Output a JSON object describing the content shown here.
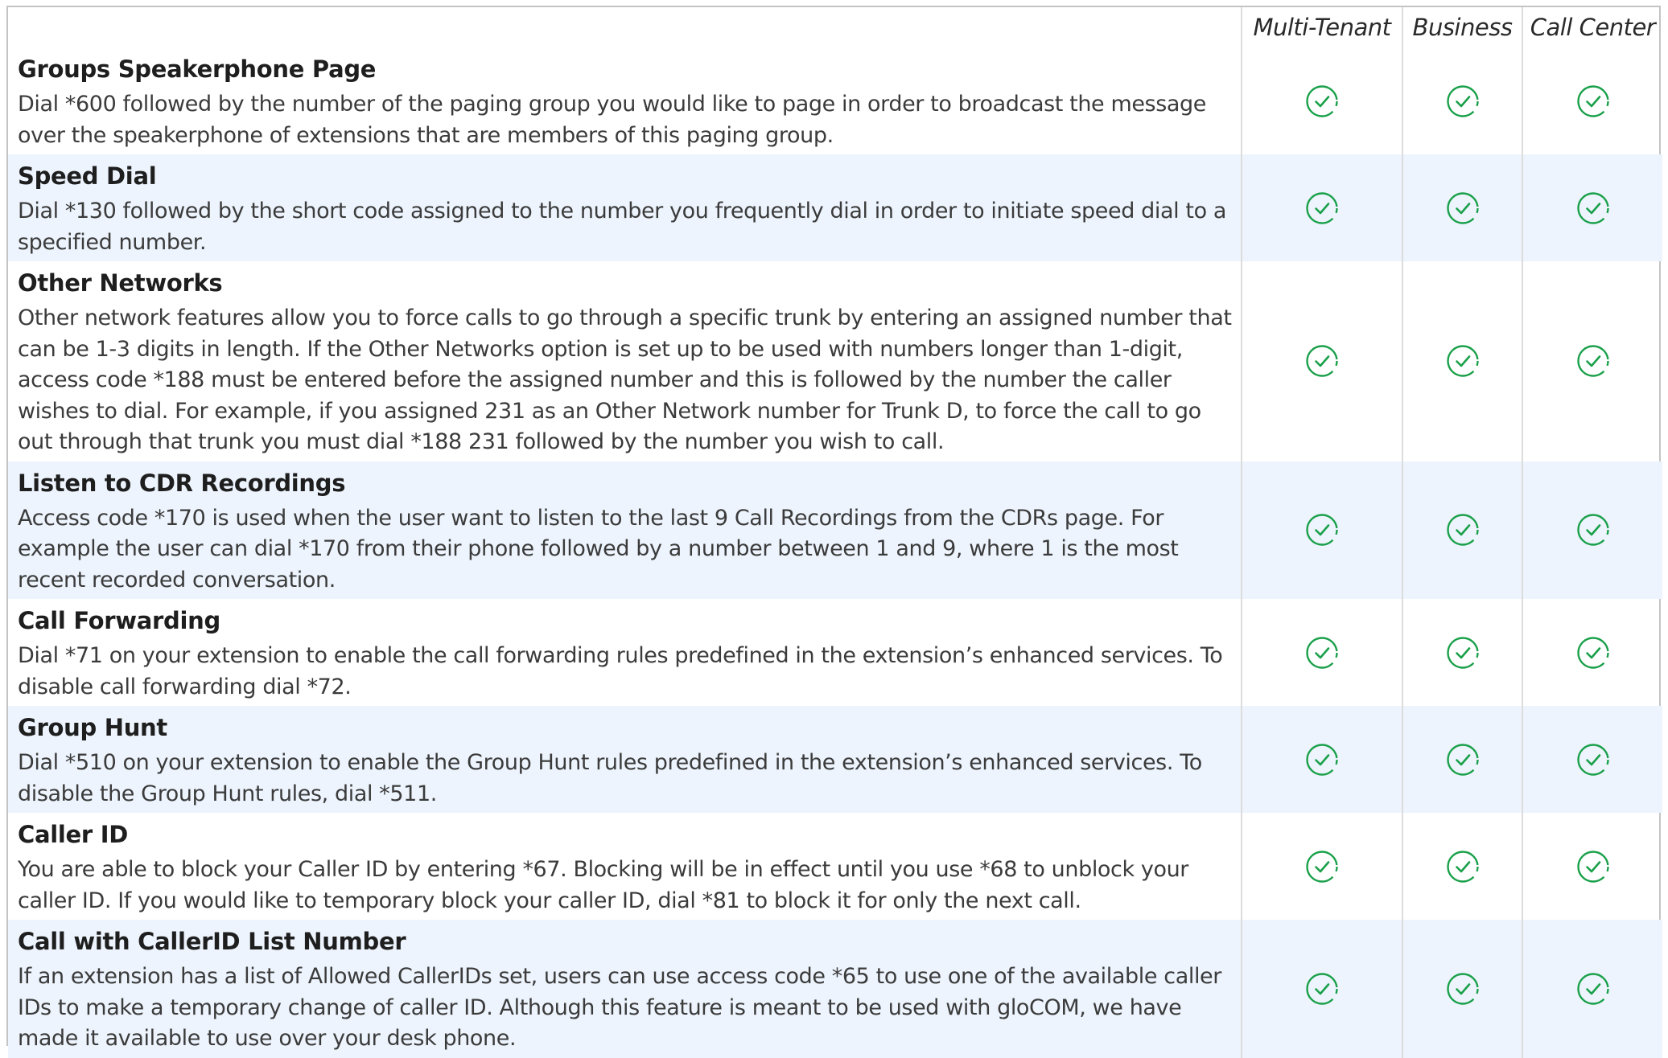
{
  "columns": {
    "multi_tenant": "Multi-Tenant",
    "business": "Business",
    "call_center": "Call Center"
  },
  "colors": {
    "check_green": "#1aa04a",
    "alt_row_bg": "#edf4fd",
    "border": "#dcdcdc"
  },
  "icons": {
    "availability": "check-circle-icon"
  },
  "features": [
    {
      "title": "Groups Speakerphone Page",
      "description": "Dial *600 followed by the number of the paging group you would like to page in order to broadcast the message over the speakerphone of extensions that are members of this paging group."
    },
    {
      "title": "Speed Dial",
      "description": "Dial *130 followed by the short code assigned to the number you frequently dial in order to initiate speed dial to a specified number."
    },
    {
      "title": "Other Networks",
      "description": "Other network features allow you to force calls to go through a specific trunk by entering an assigned number that can be 1-3 digits in length. If the Other Networks option is set up to be used with numbers longer than 1-digit, access code *188 must be entered before the assigned number and this is followed by the number the caller wishes to dial. For example, if you assigned 231 as an Other Network number for Trunk D, to force the call to go out through that trunk you must dial *188 231 followed by the number you wish to call."
    },
    {
      "title": "Listen to CDR Recordings",
      "description": "Access code *170 is used when the user want to listen to the last 9 Call Recordings from the CDRs page. For example the user can dial *170 from their phone followed by a number between 1 and 9, where 1 is the most recent recorded conversation."
    },
    {
      "title": "Call Forwarding",
      "description": "Dial *71 on your extension to enable the call forwarding rules predefined in the extension’s enhanced services. To disable call forwarding dial *72."
    },
    {
      "title": "Group Hunt",
      "description": "Dial *510 on your extension to enable the Group Hunt rules predefined in the extension’s enhanced services. To disable the Group Hunt rules, dial *511."
    },
    {
      "title": "Caller ID",
      "description": "You are able to block your Caller ID by entering *67. Blocking will be in effect until you use *68 to unblock your caller ID. If you would like to temporary block your caller ID, dial *81 to block it for only the next call."
    },
    {
      "title": "Call with CallerID List Number",
      "description": "If an extension has a list of Allowed CallerIDs set, users can use access code *65 to use one of the available caller IDs to make a temporary change of caller ID. Although this feature is meant to be used with gloCOM, we have made it available to use over your desk phone."
    }
  ]
}
